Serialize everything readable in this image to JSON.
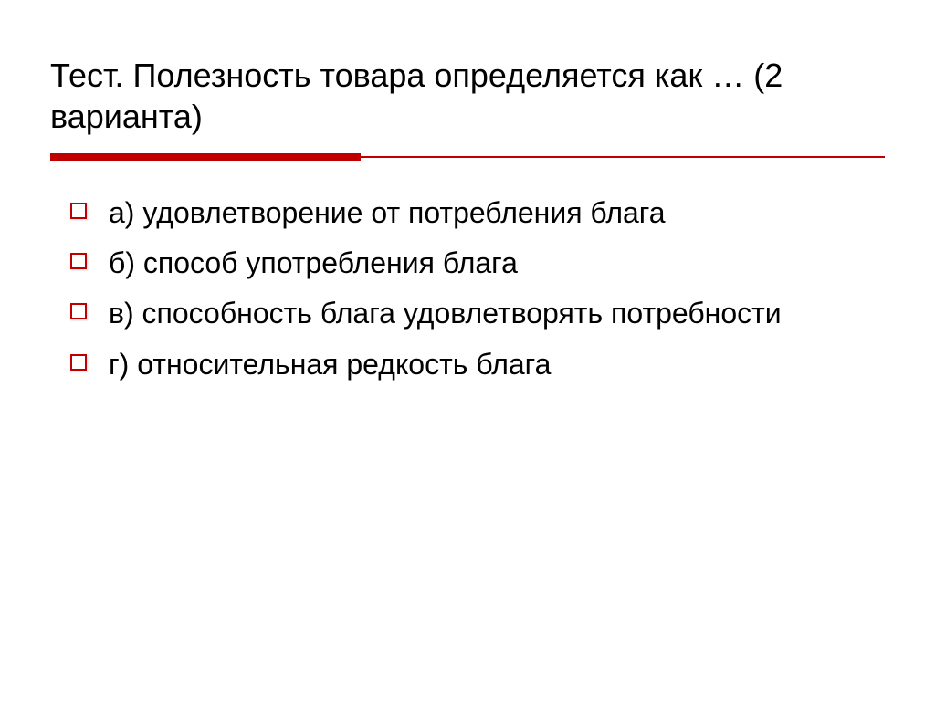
{
  "title": "Тест. Полезность товара определяется как … (2 варианта)",
  "options": [
    {
      "text": "а) удовлетворение от потребления блага"
    },
    {
      "text": "б) способ употребления блага"
    },
    {
      "text": "в) способность блага удовлетворять потребности"
    },
    {
      "text": "г) относительная редкость блага"
    }
  ]
}
